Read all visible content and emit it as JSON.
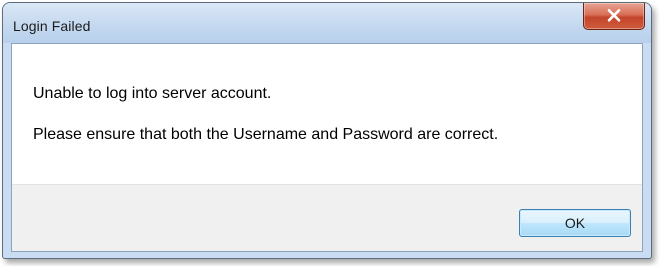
{
  "window": {
    "title": "Login Failed",
    "close_icon": "close-icon"
  },
  "message": {
    "line1": "Unable to log into server account.",
    "line2": "Please ensure that both the Username and Password are correct."
  },
  "buttons": {
    "ok_label": "OK"
  },
  "colors": {
    "close_button": "#c3452b",
    "titlebar": "#c6daf0",
    "ok_button_border": "#3c7fb1"
  }
}
